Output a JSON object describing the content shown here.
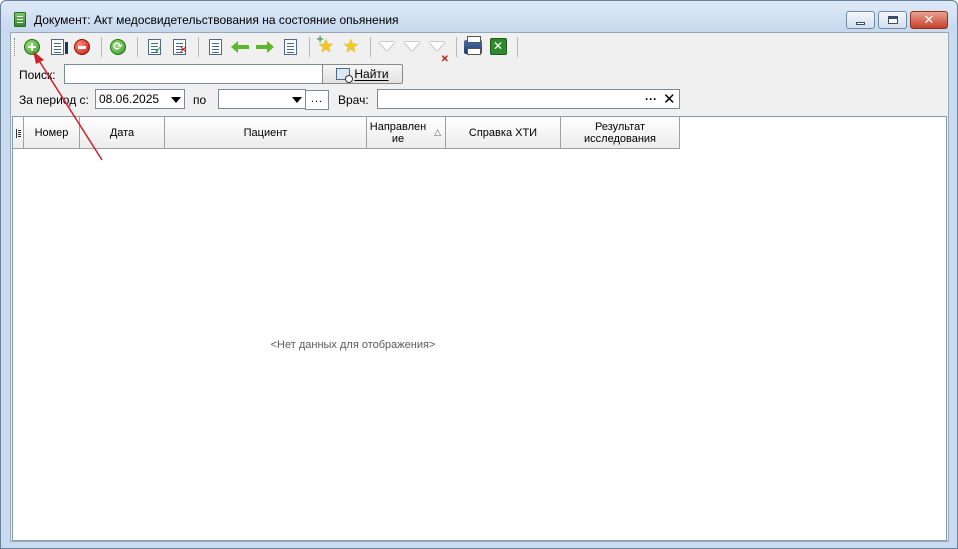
{
  "window": {
    "title": "Документ: Акт медосвидетельствования на состояние опьянения"
  },
  "toolbar": {
    "buttons": [
      {
        "name": "add",
        "icon": "add-circle-icon"
      },
      {
        "name": "edit",
        "icon": "edit-doc-icon"
      },
      {
        "name": "delete",
        "icon": "delete-circle-icon"
      },
      {
        "name": "refresh",
        "icon": "refresh-icon"
      },
      {
        "name": "approve",
        "icon": "doc-check-icon"
      },
      {
        "name": "reject",
        "icon": "doc-x-icon"
      },
      {
        "name": "move-left-doc",
        "icon": "doc-move-icon"
      },
      {
        "name": "back",
        "icon": "arrow-left-icon"
      },
      {
        "name": "forward",
        "icon": "arrow-right-icon"
      },
      {
        "name": "move-right-doc",
        "icon": "doc-move-icon"
      },
      {
        "name": "add-favorite",
        "icon": "star-add-icon"
      },
      {
        "name": "favorites",
        "icon": "star-icon"
      },
      {
        "name": "filter",
        "icon": "filter-icon"
      },
      {
        "name": "filter-edit",
        "icon": "filter-edit-icon"
      },
      {
        "name": "filter-clear",
        "icon": "filter-clear-icon"
      },
      {
        "name": "print",
        "icon": "printer-icon"
      },
      {
        "name": "export-excel",
        "icon": "excel-icon"
      }
    ]
  },
  "search": {
    "label": "Поиск:",
    "value": "",
    "button_label": "Найти"
  },
  "period": {
    "from_label": "За период с:",
    "from_value": "08.06.2025",
    "to_label": "по",
    "to_value": "",
    "more_label": "..."
  },
  "doctor": {
    "label": "Врач:",
    "value": "",
    "dots": "···",
    "clear": "✕"
  },
  "grid": {
    "columns": [
      {
        "key": "number",
        "label": "Номер"
      },
      {
        "key": "date",
        "label": "Дата"
      },
      {
        "key": "patient",
        "label": "Пациент"
      },
      {
        "key": "referral",
        "label": "Направление",
        "sorted": true
      },
      {
        "key": "hti",
        "label": "Справка ХТИ"
      },
      {
        "key": "result",
        "label": "Результат исследования"
      }
    ],
    "empty_text": "<Нет данных для отображения>"
  },
  "colors": {
    "title_bg": "#c6d8ee",
    "client_bg": "#f0f0f0",
    "annotation_arrow": "#d0202a"
  }
}
